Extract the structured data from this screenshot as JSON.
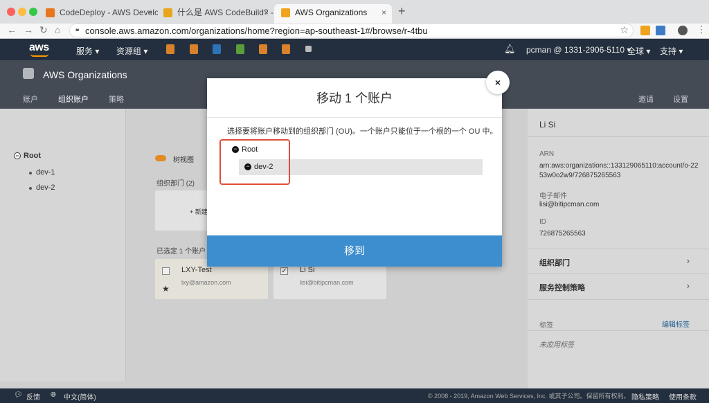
{
  "browser": {
    "tabs": [
      {
        "title": "CodeDeploy - AWS Developer",
        "favicon_color": "#e8761c"
      },
      {
        "title": "什么是 AWS CodeBuild? - AW",
        "favicon_color": "#e8a61c"
      },
      {
        "title": "AWS Organizations",
        "favicon_color": "#f0a31e"
      }
    ],
    "tab_close": "×",
    "new_tab": "+",
    "url": "console.aws.amazon.com/organizations/home?region=ap-southeast-1#/browse/r-4tbu"
  },
  "aws_nav": {
    "logo": "aws",
    "services": "服务 ▾",
    "resource_groups": "资源组 ▾",
    "account": "pcman @ 1331-2906-5110 ▾",
    "region": "全球 ▾",
    "support": "支持 ▾",
    "service_icon_colors": [
      "#d9822b",
      "#d9822b",
      "#2e73b8",
      "#5a9e3a",
      "#d9822b",
      "#d9822b",
      "#bbbbbb"
    ]
  },
  "org_header": {
    "title": "AWS Organizations",
    "tabs": [
      "账户",
      "组织账户",
      "策略"
    ],
    "right_tabs": [
      "邀请",
      "设置"
    ]
  },
  "left_tree": {
    "root": "Root",
    "children": [
      "dev-1",
      "dev-2"
    ]
  },
  "center": {
    "tree_view": "树视图",
    "org_units": "组织部门 (2)",
    "new_ou": "+ 新建",
    "selected": "已选定 1 个账户",
    "cards": [
      {
        "name": "LXY-Test",
        "email": "lxy@amazon.com"
      },
      {
        "name": "Li Si",
        "email": "lisi@bitipcman.com"
      }
    ]
  },
  "right_panel": {
    "name": "Li Si",
    "arn_label": "ARN",
    "arn_value_1": "arn:aws:organizations::133129065110:account/o-22",
    "arn_value_2": "53w0o2w9/726875265563",
    "email_label": "电子邮件",
    "email_value": "lisi@bitipcman.com",
    "id_label": "ID",
    "id_value": "726875265563",
    "org_unit": "组织部门",
    "scp": "服务控制策略",
    "tags_label": "标签",
    "edit_tags": "编辑标签",
    "no_tags": "未应用标签"
  },
  "footer": {
    "feedback": "反馈",
    "language": "中文(简体)",
    "copyright": "© 2008 - 2019, Amazon Web Services, Inc. 或其子公司。保留所有权利。",
    "privacy": "隐私策略",
    "terms": "使用条款"
  },
  "modal": {
    "title": "移动 1 个账户",
    "description": "选择要将账户移动到的组织部门 (OU)。一个账户只能位于一个根的一个 OU 中。",
    "root": "Root",
    "child": "dev-2",
    "button": "移到",
    "close": "×",
    "minus": "−"
  }
}
